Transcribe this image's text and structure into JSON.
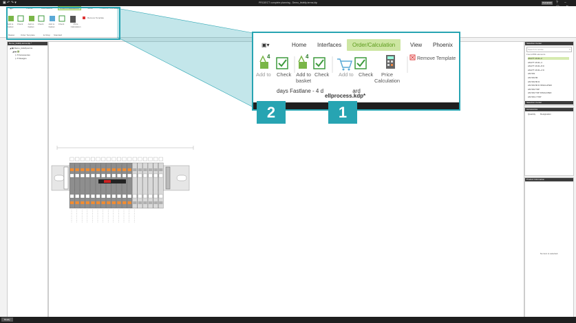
{
  "window": {
    "title": "PROJECT complete planning - Demo_ttsfelly.terms.ktp",
    "logo": "PHOENIX"
  },
  "ribbon": {
    "tabs": [
      "Home",
      "Interfaces",
      "Order/Calculation",
      "View",
      "Phoenix Contact"
    ],
    "active_tab": "Order/Calculation",
    "buttons": [
      "Add to basket",
      "Check",
      "Add to basket",
      "Check",
      "Add to basket",
      "Check",
      "Price Calculation",
      "Remove Template"
    ],
    "groups": [
      "Basket",
      "Order Template",
      "E-Shop",
      "Standard"
    ]
  },
  "zoom": {
    "tabs": [
      "Home",
      "Interfaces",
      "Order/Calculation",
      "View",
      "Phoenix"
    ],
    "buttons": {
      "add_to_1": "Add to",
      "check_1": "Check",
      "add_to_basket": "Add to\nbasket",
      "check_2": "Check",
      "add_to_3": "Add to",
      "check_3": "Check",
      "price_calc": "Price\nCalculation",
      "remove_template": "Remove Template"
    },
    "badge_2": "4",
    "badge_4": "4",
    "delivery": "days  Fastlane - 4 d",
    "delivery_tail": "ard",
    "filename": "ellprocess.kdp*",
    "callouts": [
      "2",
      "1"
    ]
  },
  "left_panel": {
    "header": "Demo_ttsfelly.terms.ktp *",
    "tree": [
      "Demo_ttsfelly.terms",
      "All",
      "Accessories",
      "Designs"
    ]
  },
  "right_panels": {
    "top": {
      "header": "Selection Center",
      "search_placeholder": "Search for article",
      "found_label": "Found 893 elements",
      "items": [
        "AM-PT 16 RL-2",
        "AM-PT 16 RL-4",
        "AM-PT 16 RL-8 D",
        "AM-PT 16 RL-2 D",
        "AM SW",
        "AM SW 80",
        "AM SW 80 D",
        "AM SW 80 D INSULATED",
        "AM SW TOP",
        "AM SW TOP INSULATED",
        "AM SW 2 TOP"
      ],
      "footer": "Selection Center"
    },
    "middle": {
      "header": "Accessories",
      "columns": [
        "Quantity",
        "Designation"
      ]
    },
    "bottom": {
      "header": "Product Information",
      "empty_text": "No item is selected."
    }
  },
  "status": {
    "label": "Ready"
  },
  "colors": {
    "accent": "#27a4b2",
    "active_tab": "#cde6a2",
    "terminal_orange": "#f08c32",
    "terminal_gray": "#8e8e8e"
  }
}
